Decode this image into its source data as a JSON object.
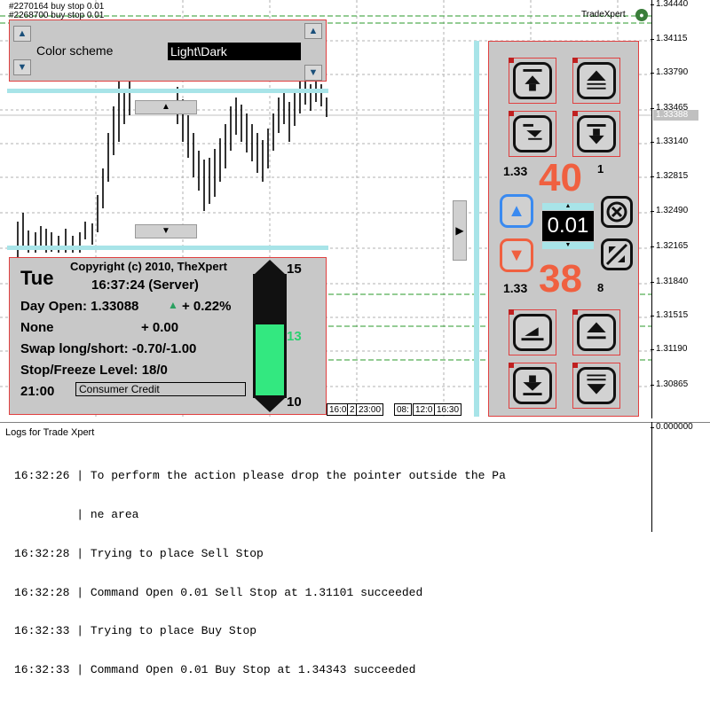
{
  "orders": [
    "#2270164 buy stop 0.01",
    "#2268700 buy stop 0.01"
  ],
  "brand": "TradeXpert",
  "price_axis": {
    "ticks": [
      "1.34440",
      "1.34115",
      "1.33790",
      "1.33465",
      "1.33140",
      "1.32815",
      "1.32490",
      "1.32165",
      "1.31840",
      "1.31515",
      "1.31190",
      "1.30865"
    ],
    "current": "1.33388",
    "log_tick": "0.000000"
  },
  "time_labels": [
    "16:0",
    "2",
    "23:00",
    "08:",
    "12:0",
    "16:30"
  ],
  "color_panel": {
    "label": "Color scheme",
    "value": "Light\\Dark"
  },
  "info_panel": {
    "day": "Tue",
    "copyright": "Copyright (c) 2010, TheXpert",
    "time": "16:37:24 (Server)",
    "day_open_label": "Day Open: 1.33088",
    "day_open_change": "+ 0.22%",
    "none_label": "None",
    "none_value": "+ 0.00",
    "swap": "Swap long/short: -0.70/-1.00",
    "stop_freeze": "Stop/Freeze Level: 18/0",
    "clock": "21:00",
    "news": "Consumer Credit",
    "gauge_top": "15",
    "gauge_value": "13",
    "gauge_bottom": "10"
  },
  "trade_panel": {
    "ask_prefix": "1.33",
    "ask_big": "40",
    "ask_suffix": "1",
    "bid_prefix": "1.33",
    "bid_big": "38",
    "bid_suffix": "8",
    "lot": "0.01"
  },
  "colors": {
    "accent_red": "#f06040",
    "gauge_green": "#33e880",
    "cyan": "#a8e4e8",
    "order_green": "#2a9a2a"
  },
  "log": {
    "title": "Logs for Trade Xpert",
    "lines": [
      "16:32:26 | To perform the action please drop the pointer outside the Pa",
      "         | ne area",
      "16:32:28 | Trying to place Sell Stop",
      "16:32:28 | Command Open 0.01 Sell Stop at 1.31101 succeeded",
      "16:32:33 | Trying to place Buy Stop",
      "16:32:33 | Command Open 0.01 Buy Stop at 1.34343 succeeded"
    ]
  }
}
